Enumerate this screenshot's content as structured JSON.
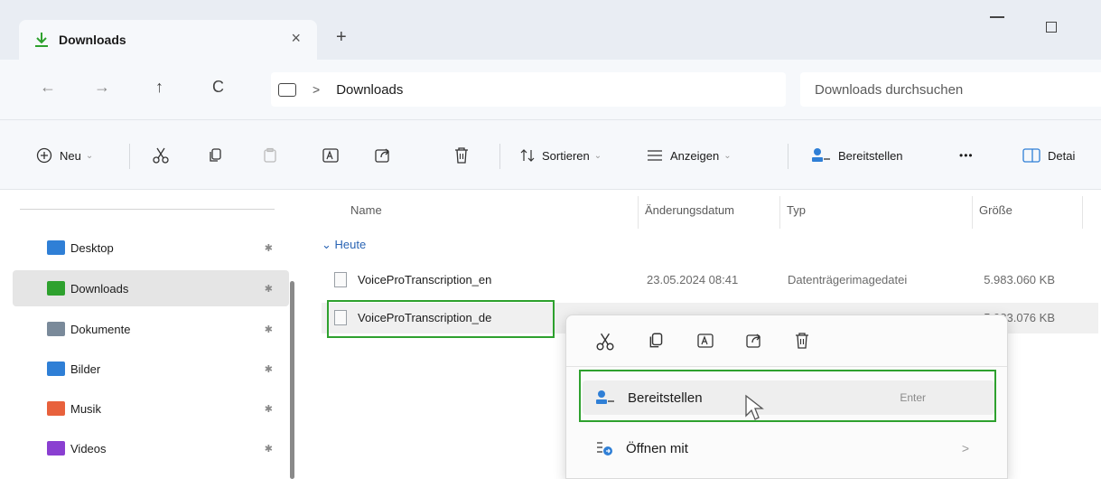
{
  "window": {
    "tab_title": "Downloads",
    "tab_close": "×",
    "new_tab": "+"
  },
  "nav": {
    "back": "←",
    "forward": "→",
    "up": "↑",
    "refresh": "C",
    "breadcrumb_sep": ">",
    "breadcrumb": "Downloads",
    "search_placeholder": "Downloads durchsuchen"
  },
  "toolbar": {
    "new_label": "Neu",
    "sort_label": "Sortieren",
    "view_label": "Anzeigen",
    "share_label": "Bereitstellen",
    "more_label": "•••",
    "details_label": "Detai"
  },
  "sidebar": {
    "pin": "✱",
    "items": [
      {
        "label": "Desktop",
        "color": "#2f7fd6"
      },
      {
        "label": "Downloads",
        "color": "#2ea12e"
      },
      {
        "label": "Dokumente",
        "color": "#7a8a9a"
      },
      {
        "label": "Bilder",
        "color": "#2f7fd6"
      },
      {
        "label": "Musik",
        "color": "#e8613c"
      },
      {
        "label": "Videos",
        "color": "#8a3fd1"
      }
    ]
  },
  "filelist": {
    "columns": {
      "name": "Name",
      "date": "Änderungsdatum",
      "type": "Typ",
      "size": "Größe"
    },
    "group": "Heute",
    "rows": [
      {
        "name": "VoiceProTranscription_en",
        "date": "23.05.2024 08:41",
        "type": "Datenträgerimagedatei",
        "size": "5.983.060 KB"
      },
      {
        "name": "VoiceProTranscription_de",
        "date": "",
        "type": "",
        "size": "5.983.076 KB"
      }
    ]
  },
  "context_menu": {
    "items": [
      {
        "label": "Bereitstellen",
        "shortcut": "Enter"
      },
      {
        "label": "Öffnen mit",
        "arrow": ">"
      }
    ]
  },
  "colors": {
    "highlight_green": "#2ea12e",
    "accent_blue": "#2a64b4"
  }
}
